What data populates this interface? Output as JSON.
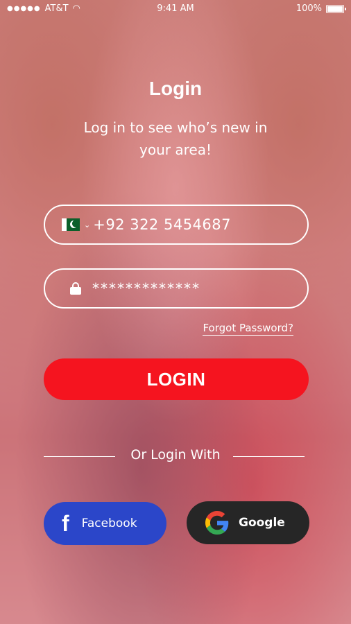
{
  "status_bar": {
    "signal": "●●●●●",
    "carrier": "AT&T",
    "wifi": "◠",
    "time": "9:41 AM",
    "battery_text": "100%",
    "battery_level": 1.0
  },
  "login": {
    "title": "Login",
    "subtitle": "Log in to see who’s new in your area!",
    "phone_value": "+92 322 5454687",
    "country_chevron": "⌄",
    "password_value": "*************",
    "forgot_password": "Forgot Password?",
    "login_button": "LOGIN",
    "or_text": "Or Login With",
    "facebook_icon_glyph": "f",
    "facebook_label": "Facebook",
    "google_label": "Google"
  },
  "colors": {
    "login_button": "#f5141f",
    "facebook": "#2b46c9",
    "google_button": "#262626",
    "overlay": "#d65c6c"
  }
}
